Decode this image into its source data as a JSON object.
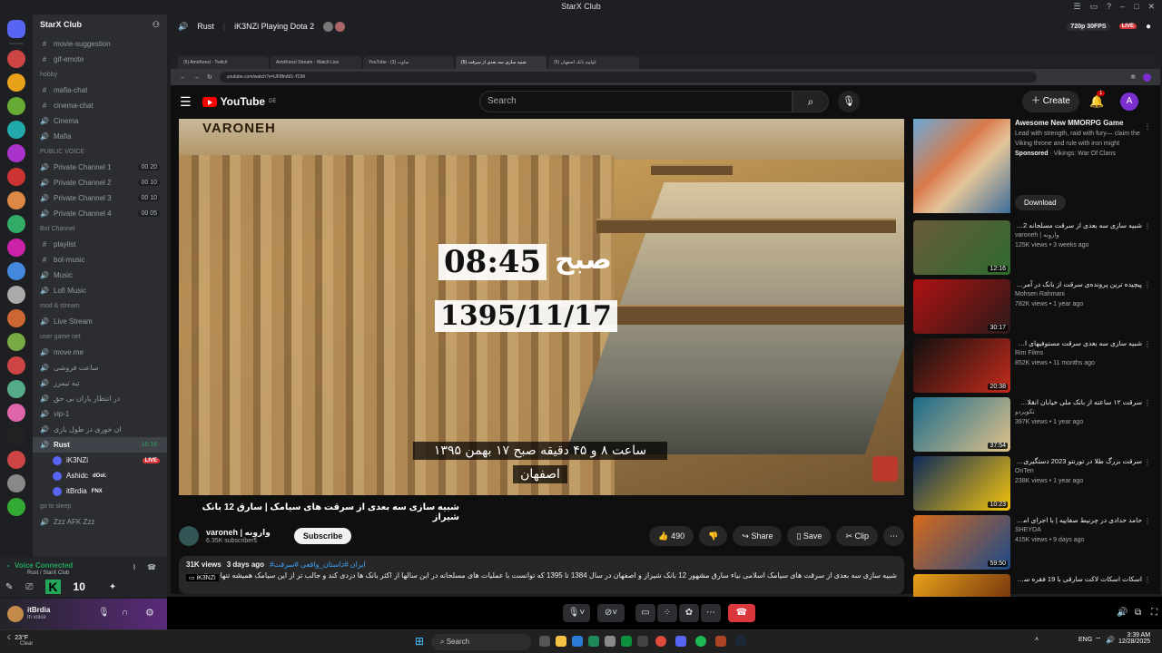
{
  "window": {
    "title": "StarX Club"
  },
  "server": {
    "name": "StarX Club"
  },
  "channels": [
    {
      "kind": "text",
      "name": "movie-suggestion"
    },
    {
      "kind": "text",
      "name": "gif-emote"
    },
    {
      "kind": "cat",
      "name": "hobby"
    },
    {
      "kind": "text",
      "name": "mafia-chat"
    },
    {
      "kind": "text",
      "name": "cinema-chat"
    },
    {
      "kind": "voice",
      "name": "Cinema"
    },
    {
      "kind": "voice",
      "name": "Mafia"
    },
    {
      "kind": "cat",
      "name": "PUBLIC VOICE"
    },
    {
      "kind": "voice",
      "name": "Private Channel 1",
      "count": "00 20"
    },
    {
      "kind": "voice",
      "name": "Private Channel 2",
      "count": "00 10"
    },
    {
      "kind": "voice",
      "name": "Private Channel 3",
      "count": "00 10"
    },
    {
      "kind": "voice",
      "name": "Private Channel 4",
      "count": "00 05"
    },
    {
      "kind": "cat",
      "name": "Bot Channel"
    },
    {
      "kind": "text",
      "name": "playlist"
    },
    {
      "kind": "text",
      "name": "bot-music"
    },
    {
      "kind": "voice",
      "name": "Music"
    },
    {
      "kind": "voice",
      "name": "Lofi Music"
    },
    {
      "kind": "cat",
      "name": "mod & stream"
    },
    {
      "kind": "voice",
      "name": "Live Stream"
    },
    {
      "kind": "cat",
      "name": "user game net"
    },
    {
      "kind": "voice",
      "name": "move me"
    },
    {
      "kind": "voice",
      "name": "ساعت فروشی"
    },
    {
      "kind": "voice",
      "name": "تبه تیمرز"
    },
    {
      "kind": "voice",
      "name": "در انتظار یاران بی حق"
    },
    {
      "kind": "voice",
      "name": "vip-1"
    },
    {
      "kind": "voice",
      "name": "ان خوری در طول بازی"
    }
  ],
  "active_voice": {
    "name": "Rust",
    "count": "16:18"
  },
  "voice_users": [
    {
      "name": "iK3NZi",
      "badge": "LIVE"
    },
    {
      "name": "Ashidc",
      "badge": "dOol."
    },
    {
      "name": "itBrdia",
      "badge": "FNX"
    }
  ],
  "after_users": [
    {
      "kind": "cat",
      "name": "go to sleep"
    },
    {
      "kind": "voice",
      "name": "Zzz AFK Zzz"
    }
  ],
  "voice_panel": {
    "status": "Voice Connected",
    "sub": "Rust / StarX Club"
  },
  "user_panel": {
    "name": "itBrdia",
    "status": "In voice"
  },
  "stream_header": {
    "channel": "Rust",
    "title": "iK3NZi Playing Dota 2",
    "quality": "720p 30FPS",
    "live": "LIVE"
  },
  "browser": {
    "tabs": [
      "(5) AmirKenzi - Twitch",
      "AmirKenzi Stream - Watch Live",
      "YouTube - (3) ساوت",
      "شبیه سازی سه بعدی از سرقت (5)",
      "(5) کولوم بانک اصفهان"
    ],
    "url": "youtube.com/watch?v=UF8fmM1-YDM"
  },
  "youtube": {
    "search_placeholder": "Search",
    "create_label": "Create",
    "notif_count": "1",
    "avatar_letter": "A",
    "country": "DE"
  },
  "video": {
    "watermark": "VARONEH",
    "time_overlay": "08:45",
    "time_word": "صبح",
    "date_overlay": "1395/11/17",
    "subtitle_line1": "ساعت ۸ و ۴۵ دقیقه صبح ۱۷ بهمن ۱۳۹۵",
    "subtitle_line2": "اصفهان",
    "title": "شبیه سازی سه بعدی از سرقت های سیامک | سارق 12 بانک شیراز",
    "channel": "varoneh | واروِنه",
    "subscribers": "6.35K subscribers",
    "subscribe": "Subscribe",
    "likes": "490",
    "share": "Share",
    "save": "Save",
    "clip": "Clip",
    "views": "31K views",
    "ago": "3 days ago",
    "tags": "#ایران #داستان_واقعی #سرقت",
    "description": "شبیه سازی سه بعدی از سرقت های سیامک اسلامی نیاء سارق مشهور 12 بانک شیراز و اصفهان در سال 1384 تا 1395 که توانست با عملیات های مسلحانه در این سالها از اکثر بانک ها دزدی کند و جالب تر از این سیامک همیشه تنها سرقت و به ک",
    "viewer": "iK3NZi"
  },
  "ad": {
    "title": "Awesome New MMORPG Game",
    "desc": "Lead with strength, raid with fury— claim the Viking throne and rule with iron might",
    "sponsor": "Sponsored",
    "sponsor_name": "Vikings: War Of Clans",
    "cta": "Download"
  },
  "recs": [
    {
      "title": "شبیه سازی سه بعدی از سرقت مسلحانه 42 کیلو طلا در بازار تهران",
      "channel": "varoneh | واروِنه",
      "meta": "125K views • 3 weeks ago",
      "dur": "12:16",
      "c1": "#6a5a3a",
      "c2": "#2e6b2e"
    },
    {
      "title": "پیچیده ترین پرونده‌ی سرقت از بانک در آمریکا (تصاویر مستند)",
      "channel": "Mohsen Rahmani",
      "meta": "782K views • 1 year ago",
      "dur": "30:17",
      "c1": "#b01212",
      "c2": "#2a1a1a"
    },
    {
      "title": "شبیه سازی سه بعدی سرقت مستوفیهای اسناد بانک ملی",
      "channel": "Rim Films",
      "meta": "852K views • 11 months ago",
      "dur": "20:38",
      "c1": "#111",
      "c2": "#c42a1a"
    },
    {
      "title": "سرقت ۱۲ ساعته از بانک ملی خیابان انقلاب | جزئیات عملیات چه بود؟",
      "channel": "تکوپردو",
      "meta": "397K views • 1 year ago",
      "dur": "37:54",
      "c1": "#1a6a8a",
      "c2": "#e0c28a"
    },
    {
      "title": "سرقت بزرگ طلا در تورنتو 2023 دستگیری تعدادی از کارکنان فرودگاه 2024",
      "channel": "OnTen",
      "meta": "238K views • 1 year ago",
      "dur": "10:23",
      "c1": "#0d2a5a",
      "c2": "#f5c40d"
    },
    {
      "title": "حامد حدادی در چرنیط صفاییه | با اجرای امیرحسین قیاسی | از پالتوم شیدا",
      "channel": "SHEYDA",
      "meta": "415K views • 9 days ago",
      "dur": "59:50",
      "c1": "#d86a1a",
      "c2": "#1a4a8a"
    },
    {
      "title": "اسکات اسکات لاکت سارقی با 19 فقره سرقت از بانک",
      "channel": "",
      "meta": "",
      "dur": "",
      "c1": "#e8a21a",
      "c2": "#5a1a0a"
    }
  ],
  "callbar": {
    "leave_icon": "leave-call"
  },
  "taskbar": {
    "weather": "23°F",
    "weather_sub": "Clear",
    "search": "Search",
    "lang": "ENG",
    "time": "3:39 AM",
    "date": "12/28/2025"
  },
  "colors": {
    "discord_bg": "#2b2d31",
    "youtube_red": "#ff0000",
    "live_red": "#da373c",
    "online_green": "#23a55a",
    "blurple": "#5865f2"
  }
}
